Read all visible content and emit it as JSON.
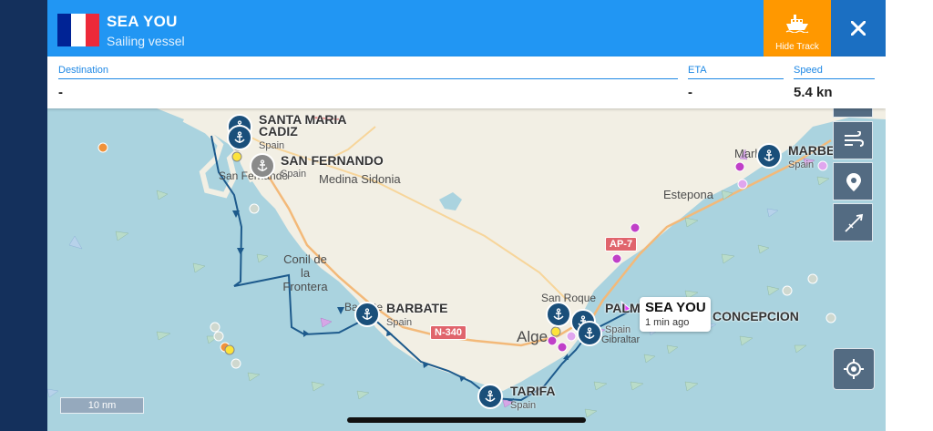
{
  "vessel": {
    "name": "SEA YOU",
    "type": "Sailing vessel",
    "flag_colors": [
      "#002395",
      "#ffffff",
      "#ed2939"
    ]
  },
  "actions": {
    "hide_track_label": "Hide Track",
    "hide_track_icon": "ship-icon",
    "close_icon": "close-icon"
  },
  "info": {
    "destination_label": "Destination",
    "destination_value": "-",
    "eta_label": "ETA",
    "eta_value": "-",
    "speed_label": "Speed",
    "speed_value": "5.4 kn"
  },
  "map": {
    "places": [
      "Medina Sidonia",
      "San Fernando",
      "Conil de la Frontera",
      "Barbate",
      "San Roque",
      "Alge",
      "Estepona",
      "Gibraltar",
      "Marbella"
    ],
    "ports": [
      {
        "name": "SANTA MARIA",
        "country": ""
      },
      {
        "name": "CADIZ",
        "country": "Spain"
      },
      {
        "name": "SAN FERNANDO",
        "country": "Spain"
      },
      {
        "name": "BARBATE",
        "country": "Spain"
      },
      {
        "name": "TARIFA",
        "country": "Spain"
      },
      {
        "name": "PALMON",
        "country": "Spain"
      },
      {
        "name": "CONCEPCION",
        "country": ""
      },
      {
        "name": "MARBELLA",
        "country": "Spain"
      }
    ],
    "roads": [
      "AP-7",
      "N-340"
    ],
    "vessel_callout": {
      "name": "SEA YOU",
      "age": "1 min ago"
    },
    "scale": "10 nm",
    "colors": {
      "sea": "#aad3df",
      "land": "#f2efe4",
      "track": "#1d5a8c",
      "header": "#2196f3",
      "hide_track": "#ff9800"
    }
  },
  "controls": [
    "layers-icon",
    "wind-icon",
    "location-pin-icon",
    "compass-icon",
    "my-location-icon"
  ]
}
